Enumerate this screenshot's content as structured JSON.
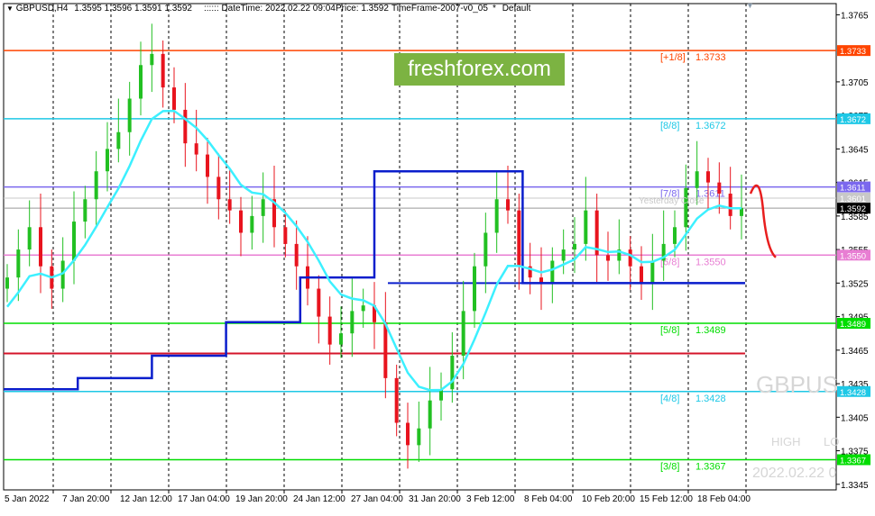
{
  "header": {
    "symbol": "GBPUSD,H4",
    "ohlc": "1.3595 1.3596 1.3591 1.3592",
    "datetime": ":::::: DateTime: 2022.02.22 09:04",
    "price": "Price: 1.3592",
    "timeframe": "TimeFrame-2007-v0_05",
    "default_label": "Default",
    "dropdown_icon": "triangle-down-icon"
  },
  "watermark": {
    "brand": "freshforex.com",
    "symbol": "GBPUS",
    "high_label": "HIGH",
    "low_label": "LO",
    "date": "2022.02.22 0",
    "yesterday_label": "Yesterday Close"
  },
  "colors": {
    "brand_bg": "#7cb342",
    "plus_one_eighth": "#ff4500",
    "eight_eighths": "#1ec8e6",
    "seven_eighths": "#7b68ee",
    "six_eighths": "#e87ed3",
    "five_eighths": "#00dd00",
    "four_eighths": "#1ec8e6",
    "three_eighths": "#00dd00",
    "bull_candle": "#22c022",
    "bear_candle": "#e8141e",
    "fast_ma": "#3cf0ff",
    "fast_ma_alt": "#ff22ff",
    "slow_ma": "#0a1ecc",
    "slow_ma_alt": "#e81e1e"
  },
  "levels": [
    {
      "key": "plus_one_eighth",
      "label": "[+1/8]",
      "value": "1.3733",
      "badge": "1.3733",
      "color": "#ff4500",
      "badge_text": "#ffffff"
    },
    {
      "key": "eight_eighths",
      "label": "[8/8]",
      "value": "1.3672",
      "badge": "1.3672",
      "color": "#1ec8e6",
      "badge_text": "#ffffff"
    },
    {
      "key": "seven_eighths",
      "label": "[7/8]",
      "value": "1.3611",
      "badge": "1.3611",
      "color": "#7b68ee",
      "badge_text": "#ffffff"
    },
    {
      "key": "six_eighths",
      "label": "[6/8]",
      "value": "1.3550",
      "badge": "1.3550",
      "color": "#e87ed3",
      "badge_text": "#ffffff"
    },
    {
      "key": "five_eighths",
      "label": "[5/8]",
      "value": "1.3489",
      "badge": "1.3489",
      "color": "#00dd00",
      "badge_text": "#ffffff"
    },
    {
      "key": "four_eighths",
      "label": "[4/8]",
      "value": "1.3428",
      "badge": "1.3428",
      "color": "#1ec8e6",
      "badge_text": "#ffffff"
    },
    {
      "key": "three_eighths",
      "label": "[3/8]",
      "value": "1.3367",
      "badge": "1.3367",
      "color": "#00dd00",
      "badge_text": "#ffffff"
    }
  ],
  "extra_badges": [
    {
      "value": "1.3601",
      "bg": "#c8c8c8",
      "fg": "#ffffff"
    },
    {
      "value": "1.3592",
      "bg": "#000000",
      "fg": "#ffffff"
    }
  ],
  "y_axis": {
    "ticks": [
      "1.3765",
      "1.3705",
      "1.3675",
      "1.3645",
      "1.3615",
      "1.3585",
      "1.3555",
      "1.3525",
      "1.3495",
      "1.3465",
      "1.3435",
      "1.3405",
      "1.3375",
      "1.3345"
    ]
  },
  "x_axis": {
    "ticks": [
      "5 Jan 2022",
      "7 Jan 20:00",
      "12 Jan 12:00",
      "17 Jan 04:00",
      "19 Jan 20:00",
      "24 Jan 12:00",
      "27 Jan 04:00",
      "31 Jan 20:00",
      "3 Feb 12:00",
      "8 Feb 04:00",
      "10 Feb 20:00",
      "15 Feb 12:00",
      "18 Feb 04:00"
    ]
  },
  "chart_data": {
    "type": "candlestick",
    "symbol": "GBPUSD",
    "timeframe": "H4",
    "ylim": [
      1.334,
      1.3775
    ],
    "horizontal_levels": [
      1.3733,
      1.3672,
      1.3611,
      1.355,
      1.3489,
      1.3428,
      1.3367
    ],
    "close_line": 1.3592,
    "yesterday_close": 1.3601,
    "closes": [
      1.353,
      1.3555,
      1.3575,
      1.354,
      1.352,
      1.3545,
      1.358,
      1.36,
      1.3625,
      1.3645,
      1.366,
      1.369,
      1.372,
      1.373,
      1.37,
      1.368,
      1.365,
      1.364,
      1.362,
      1.36,
      1.359,
      1.357,
      1.3585,
      1.36,
      1.3575,
      1.356,
      1.354,
      1.352,
      1.3495,
      1.347,
      1.348,
      1.35,
      1.3505,
      1.349,
      1.344,
      1.34,
      1.338,
      1.3395,
      1.342,
      1.343,
      1.346,
      1.35,
      1.354,
      1.357,
      1.36,
      1.359,
      1.354,
      1.353,
      1.3525,
      1.3545,
      1.3555,
      1.356,
      1.359,
      1.355,
      1.3545,
      1.3555,
      1.354,
      1.3525,
      1.3545,
      1.356,
      1.3575,
      1.361,
      1.3625,
      1.3615,
      1.3605,
      1.3585,
      1.3592
    ],
    "slow_ma_steps": [
      1.343,
      1.344,
      1.346,
      1.349,
      1.353,
      1.3625,
      1.3625,
      1.3525,
      1.3525,
      1.3525
    ],
    "fast_ma_start": 1.3495,
    "fast_ma_end": 1.3595
  }
}
